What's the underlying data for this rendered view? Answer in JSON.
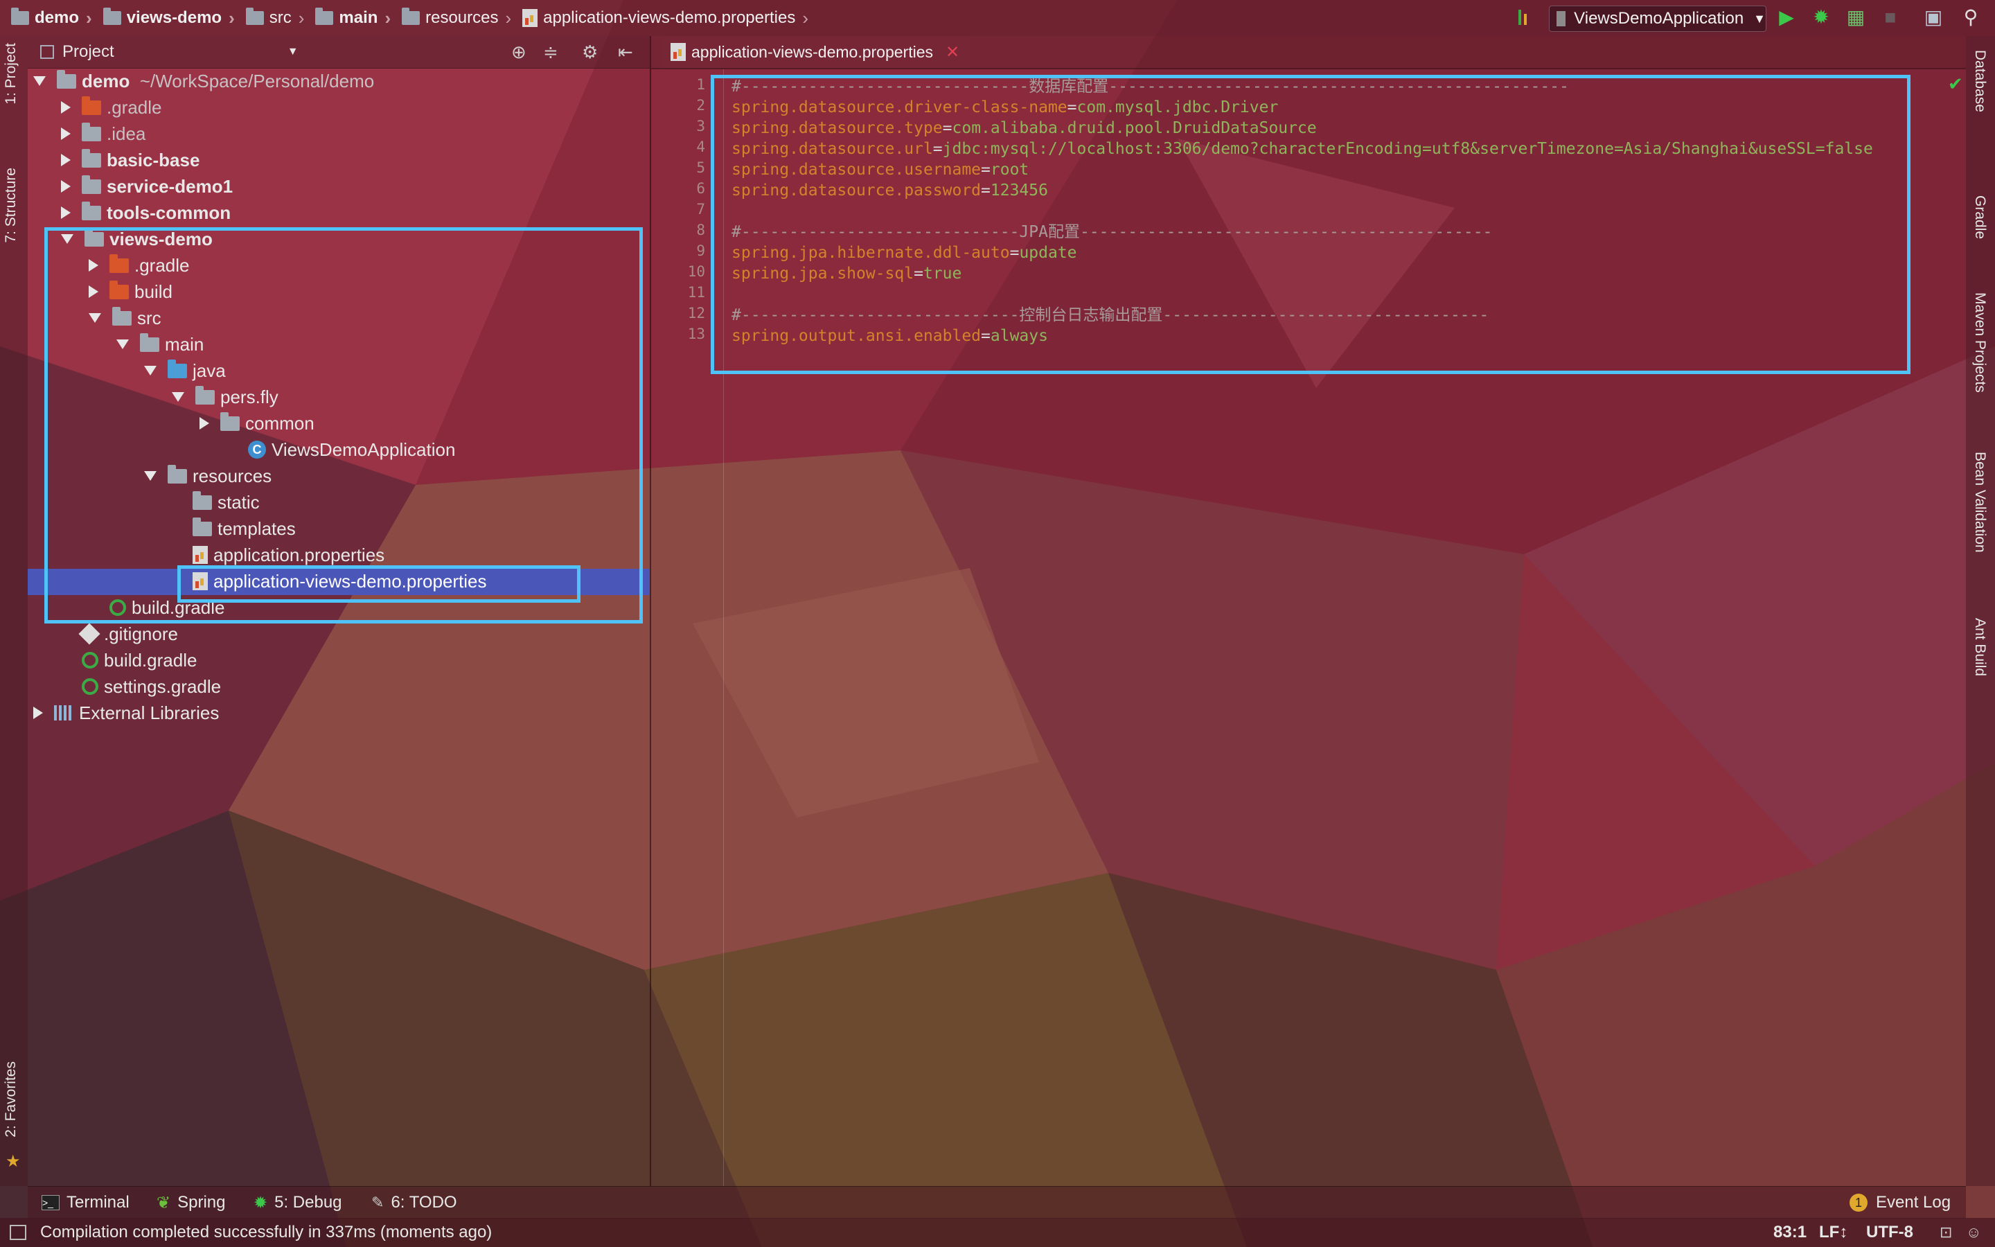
{
  "navbar": {
    "crumbs": [
      "demo",
      "views-demo",
      "src",
      "main",
      "resources",
      "application-views-demo.properties"
    ],
    "run_config": "ViewsDemoApplication"
  },
  "left_stripe": {
    "project_tab": "1: Project",
    "structure_tab": "7: Structure",
    "favorites_tab": "2: Favorites"
  },
  "right_stripe": {
    "database": "Database",
    "gradle": "Gradle",
    "maven": "Maven Projects",
    "bean": "Bean Validation",
    "ant": "Ant Build"
  },
  "project_panel": {
    "title": "Project",
    "tree": [
      {
        "label": "demo",
        "path": "~/WorkSpace/Personal/demo"
      },
      {
        "label": ".gradle"
      },
      {
        "label": ".idea"
      },
      {
        "label": "basic-base"
      },
      {
        "label": "service-demo1"
      },
      {
        "label": "tools-common"
      },
      {
        "label": "views-demo"
      },
      {
        "label": ".gradle"
      },
      {
        "label": "build"
      },
      {
        "label": "src"
      },
      {
        "label": "main"
      },
      {
        "label": "java"
      },
      {
        "label": "pers.fly"
      },
      {
        "label": "common"
      },
      {
        "label": "ViewsDemoApplication"
      },
      {
        "label": "resources"
      },
      {
        "label": "static"
      },
      {
        "label": "templates"
      },
      {
        "label": "application.properties"
      },
      {
        "label": "application-views-demo.properties"
      },
      {
        "label": "build.gradle"
      },
      {
        "label": ".gitignore"
      },
      {
        "label": "build.gradle"
      },
      {
        "label": "settings.gradle"
      },
      {
        "label": "External Libraries"
      }
    ]
  },
  "editor": {
    "tab_label": "application-views-demo.properties",
    "line_numbers": [
      "1",
      "2",
      "3",
      "4",
      "5",
      "6",
      "7",
      "8",
      "9",
      "10",
      "11",
      "12",
      "13"
    ],
    "lines": [
      {
        "comment": "#------------------------------数据库配置------------------------------------------------"
      },
      {
        "key": "spring.datasource.driver-class-name",
        "value": "com.mysql.jdbc.Driver"
      },
      {
        "key": "spring.datasource.type",
        "value": "com.alibaba.druid.pool.DruidDataSource"
      },
      {
        "key": "spring.datasource.url",
        "value": "jdbc:mysql://localhost:3306/demo?characterEncoding=utf8&serverTimezone=Asia/Shanghai&useSSL=false"
      },
      {
        "key": "spring.datasource.username",
        "value": "root"
      },
      {
        "key": "spring.datasource.password",
        "value": "123456"
      },
      {},
      {
        "comment": "#-----------------------------JPA配置-------------------------------------------"
      },
      {
        "key": "spring.jpa.hibernate.ddl-auto",
        "value": "update"
      },
      {
        "key": "spring.jpa.show-sql",
        "value": "true"
      },
      {},
      {
        "comment": "#-----------------------------控制台日志输出配置----------------------------------"
      },
      {
        "key": "spring.output.ansi.enabled",
        "value": "always"
      }
    ]
  },
  "bottom_tabs": {
    "terminal": "Terminal",
    "spring": "Spring",
    "debug": "5: Debug",
    "todo": "6: TODO",
    "event_log": "Event Log",
    "event_count": "1"
  },
  "status": {
    "message": "Compilation completed successfully in 337ms (moments ago)",
    "position": "83:1",
    "line_sep": "LF↕",
    "encoding": "UTF-8"
  }
}
